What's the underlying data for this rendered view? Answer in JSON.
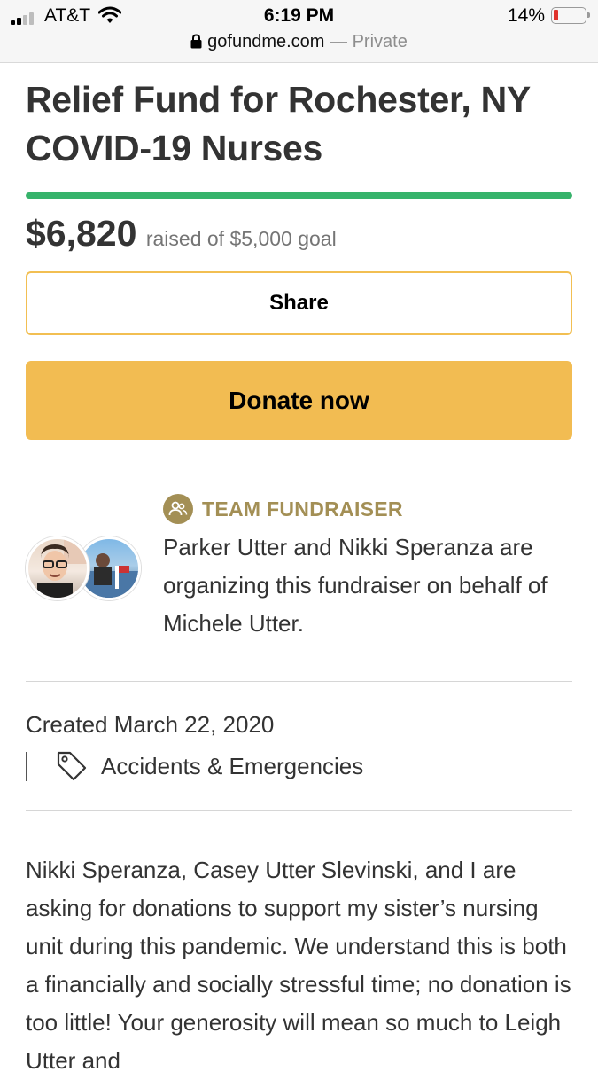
{
  "status_bar": {
    "carrier": "AT&T",
    "time": "6:19 PM",
    "battery_percent": "14%",
    "battery_level": 0.14
  },
  "browser": {
    "domain": "gofundme.com",
    "mode": "— Private"
  },
  "campaign": {
    "title": "Relief Fund for Rochester, NY COVID-19 Nurses",
    "raised_amount": "$6,820",
    "raised_text": "raised of $5,000 goal",
    "progress_fraction": 1.0,
    "progress_color": "#36b36b",
    "share_label": "Share",
    "donate_label": "Donate now",
    "accent_color": "#f2bc52"
  },
  "organizer": {
    "badge_label": "TEAM FUNDRAISER",
    "badge_icon": "team-icon",
    "badge_color": "#a38f55",
    "description": "Parker Utter and Nikki Speranza are organizing this fundraiser on behalf of Michele Utter."
  },
  "meta": {
    "created": "Created March 22, 2020",
    "category": "Accidents & Emergencies",
    "category_icon": "tag-icon"
  },
  "story": {
    "text": "Nikki Speranza, Casey Utter Slevinski, and I are asking for donations to support my sister’s nursing unit during this pandemic. We understand this is both a financially and socially stressful time; no donation is too little! Your generosity will mean so much to Leigh Utter and"
  }
}
